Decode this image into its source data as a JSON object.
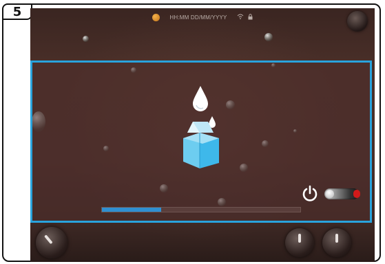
{
  "figure": {
    "step_number": "5"
  },
  "status_bar": {
    "datetime_format": "HH:MM DD/MM/YYYY",
    "indicator_icons": [
      "wifi-icon",
      "lock-icon"
    ]
  },
  "dialog": {
    "illustration": "milk-carton-with-drops",
    "progress_fraction": 0.3,
    "power_toggle": {
      "state": "off",
      "accent_color": "#d11a1a"
    },
    "accent_color": "#29a3dd",
    "progress_color": "#2f8fd1"
  },
  "colors": {
    "screen_background": "#4a2f2a",
    "panel_border": "#29a3dd"
  }
}
